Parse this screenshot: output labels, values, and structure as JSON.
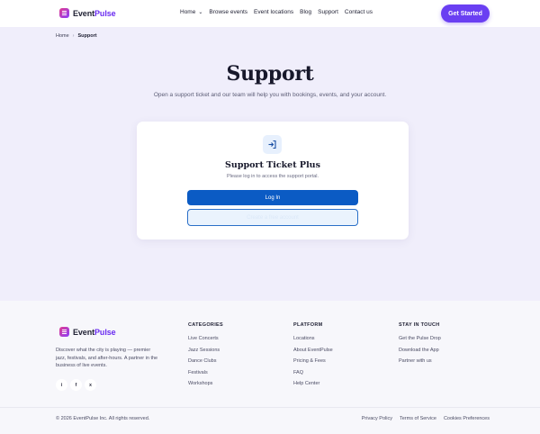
{
  "brand": {
    "name_part1": "Event",
    "name_part2": "Pulse",
    "accent": "#6a3ff2",
    "logo_icon": "ticket-icon"
  },
  "nav": {
    "items": [
      {
        "label": "Home",
        "has_dropdown": true
      },
      {
        "label": "Browse events"
      },
      {
        "label": "Event locations"
      },
      {
        "label": "Blog"
      },
      {
        "label": "Support"
      },
      {
        "label": "Contact us"
      }
    ],
    "cta": "Get Started"
  },
  "breadcrumb": {
    "home": "Home",
    "separator": "›",
    "current": "Support"
  },
  "page": {
    "title": "Support",
    "subtitle": "Open a support ticket and our team will help you with bookings, events, and your account."
  },
  "card": {
    "icon": "login-arrow-icon",
    "title": "Support Ticket Plus",
    "description": "Please log in to access the support portal.",
    "login_button": "Log In",
    "secondary_button": "Create a free account"
  },
  "footer": {
    "description": "Discover what the city is playing — premier jazz, festivals, and after-hours. A partner in the business of live events.",
    "socials": [
      "i",
      "f",
      "x"
    ],
    "columns": [
      {
        "heading": "CATEGORIES",
        "links": [
          "Live Concerts",
          "Jazz Sessions",
          "Dance Clubs",
          "Festivals",
          "Workshops"
        ]
      },
      {
        "heading": "PLATFORM",
        "links": [
          "Locations",
          "About EventPulse",
          "Pricing & Fees",
          "FAQ",
          "Help Center"
        ]
      },
      {
        "heading": "STAY IN TOUCH",
        "links": [
          "Get the Pulse Drop",
          "Download the App",
          "Partner with us"
        ]
      }
    ],
    "copyright": "© 2026 EventPulse Inc. All rights reserved.",
    "legal": [
      "Privacy Policy",
      "Terms of Service",
      "Cookies Preferences"
    ]
  }
}
